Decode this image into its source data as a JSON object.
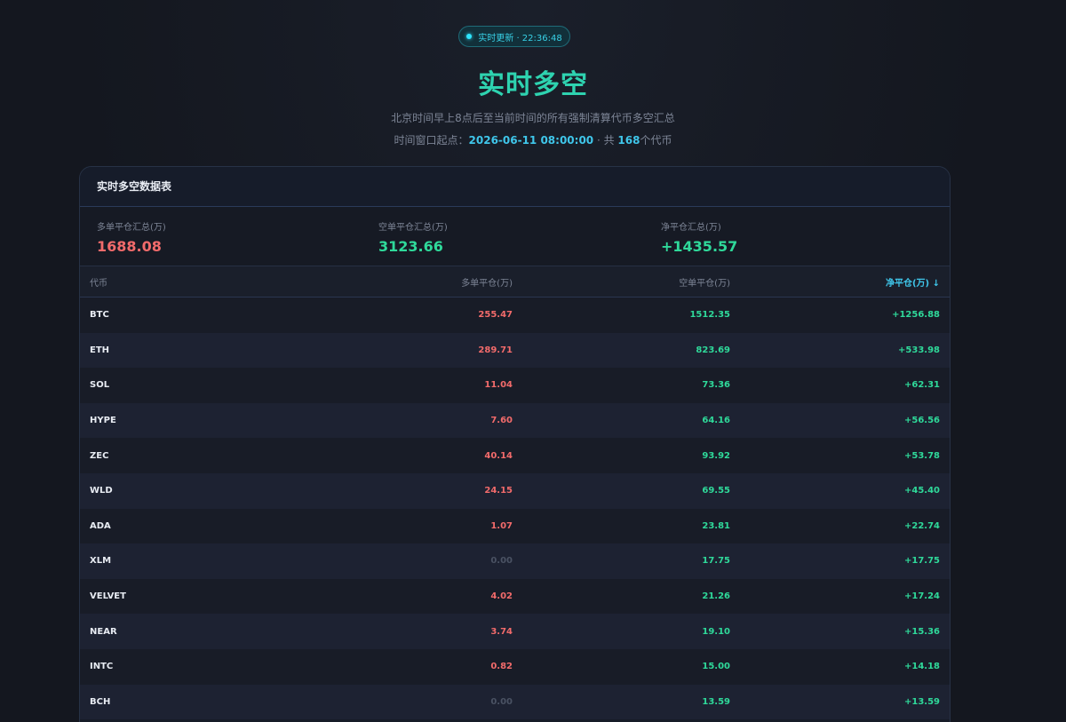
{
  "badge": {
    "text": "实时更新 · 22:36:48"
  },
  "header": {
    "title": "实时多空",
    "subtitle": "北京时间早上8点后至当前时间的所有强制清算代币多空汇总",
    "window_prefix": "时间窗口起点：",
    "window_start": "2026-06-11 08:00:00",
    "window_middle": " · 共 ",
    "token_count": "168",
    "window_suffix": "个代币"
  },
  "card": {
    "title": "实时多空数据表",
    "summary": [
      {
        "label": "多单平仓汇总(万)",
        "value": "1688.08",
        "color": "red"
      },
      {
        "label": "空单平仓汇总(万)",
        "value": "3123.66",
        "color": "green"
      },
      {
        "label": "净平仓汇总(万)",
        "value": "+1435.57",
        "color": "green"
      }
    ],
    "columns": {
      "symbol": "代币",
      "long": "多单平仓(万)",
      "short": "空单平仓(万)",
      "net": "净平仓(万) ↓"
    },
    "rows": [
      {
        "symbol": "BTC",
        "long": "255.47",
        "short": "1512.35",
        "net": "+1256.88"
      },
      {
        "symbol": "ETH",
        "long": "289.71",
        "short": "823.69",
        "net": "+533.98"
      },
      {
        "symbol": "SOL",
        "long": "11.04",
        "short": "73.36",
        "net": "+62.31"
      },
      {
        "symbol": "HYPE",
        "long": "7.60",
        "short": "64.16",
        "net": "+56.56"
      },
      {
        "symbol": "ZEC",
        "long": "40.14",
        "short": "93.92",
        "net": "+53.78"
      },
      {
        "symbol": "WLD",
        "long": "24.15",
        "short": "69.55",
        "net": "+45.40"
      },
      {
        "symbol": "ADA",
        "long": "1.07",
        "short": "23.81",
        "net": "+22.74"
      },
      {
        "symbol": "XLM",
        "long": "0.00",
        "short": "17.75",
        "net": "+17.75"
      },
      {
        "symbol": "VELVET",
        "long": "4.02",
        "short": "21.26",
        "net": "+17.24"
      },
      {
        "symbol": "NEAR",
        "long": "3.74",
        "short": "19.10",
        "net": "+15.36"
      },
      {
        "symbol": "INTC",
        "long": "0.82",
        "short": "15.00",
        "net": "+14.18"
      },
      {
        "symbol": "BCH",
        "long": "0.00",
        "short": "13.59",
        "net": "+13.59"
      }
    ]
  }
}
